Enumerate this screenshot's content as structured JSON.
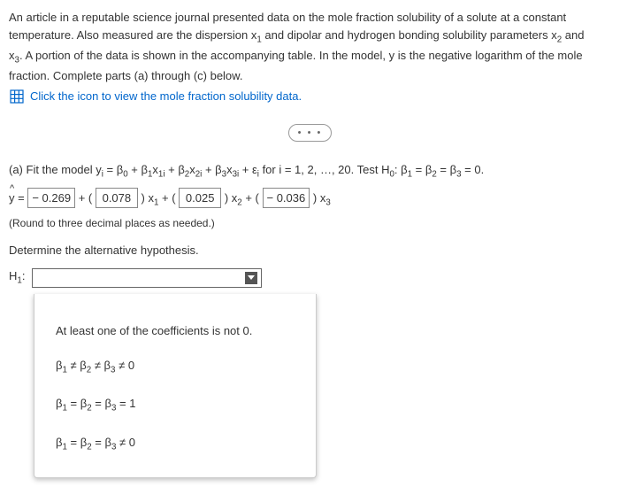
{
  "intro": {
    "line1_pre": "An article in a reputable science journal presented data on the mole fraction solubility of a solute at a constant temperature. Also measured are the dispersion x",
    "line1_s1": "1",
    "line1_mid": " and dipolar and hydrogen bonding solubility parameters x",
    "line1_s2": "2",
    "line1_post": " and",
    "line2_pre": "x",
    "line2_s3": "3",
    "line2_post": ". A portion of the data is shown in the accompanying table. In the model, y is the negative logarithm of the mole fraction. Complete parts (a) through (c) below.",
    "link": "Click the icon to view the mole fraction solubility data."
  },
  "dots": "• • •",
  "part_a": {
    "label": "(a) Fit the model y",
    "i": "i",
    "eq": " = β",
    "b0": "0",
    "plus_b1": " + β",
    "b1": "1",
    "x1": "x",
    "x1i": "1i",
    "b2": "2",
    "x2i": "2i",
    "b3": "3",
    "x3i": "3i",
    "eps": " + ε",
    "epsi": "i",
    "fori": " for i = 1, 2, …, 20. Test H",
    "h0": "0",
    "colon": ": β",
    "eq0": " = 0."
  },
  "fit": {
    "yhat_eq": " = ",
    "v0": "− 0.269",
    "plus1": " + (",
    "v1": "0.078",
    "rp1": ") x",
    "s1": "1",
    "plus2": " + (",
    "v2": "0.025",
    "rp2": ") x",
    "s2": "2",
    "plus3": " + (",
    "v3": "− 0.036",
    "rp3": ") x",
    "s3": "3"
  },
  "hint": "(Round to three decimal places as needed.)",
  "alt_label": "Determine the alternative hypothesis.",
  "h1_label_pre": "H",
  "h1_label_sub": "1",
  "h1_label_post": ":",
  "options": {
    "o1": "At least one of the coefficients is not 0.",
    "o2": "β1 ≠ β2 ≠ β3 ≠ 0",
    "o3": "β1 = β2 = β3 = 1",
    "o4": "β1 = β2 = β3 ≠ 0"
  }
}
